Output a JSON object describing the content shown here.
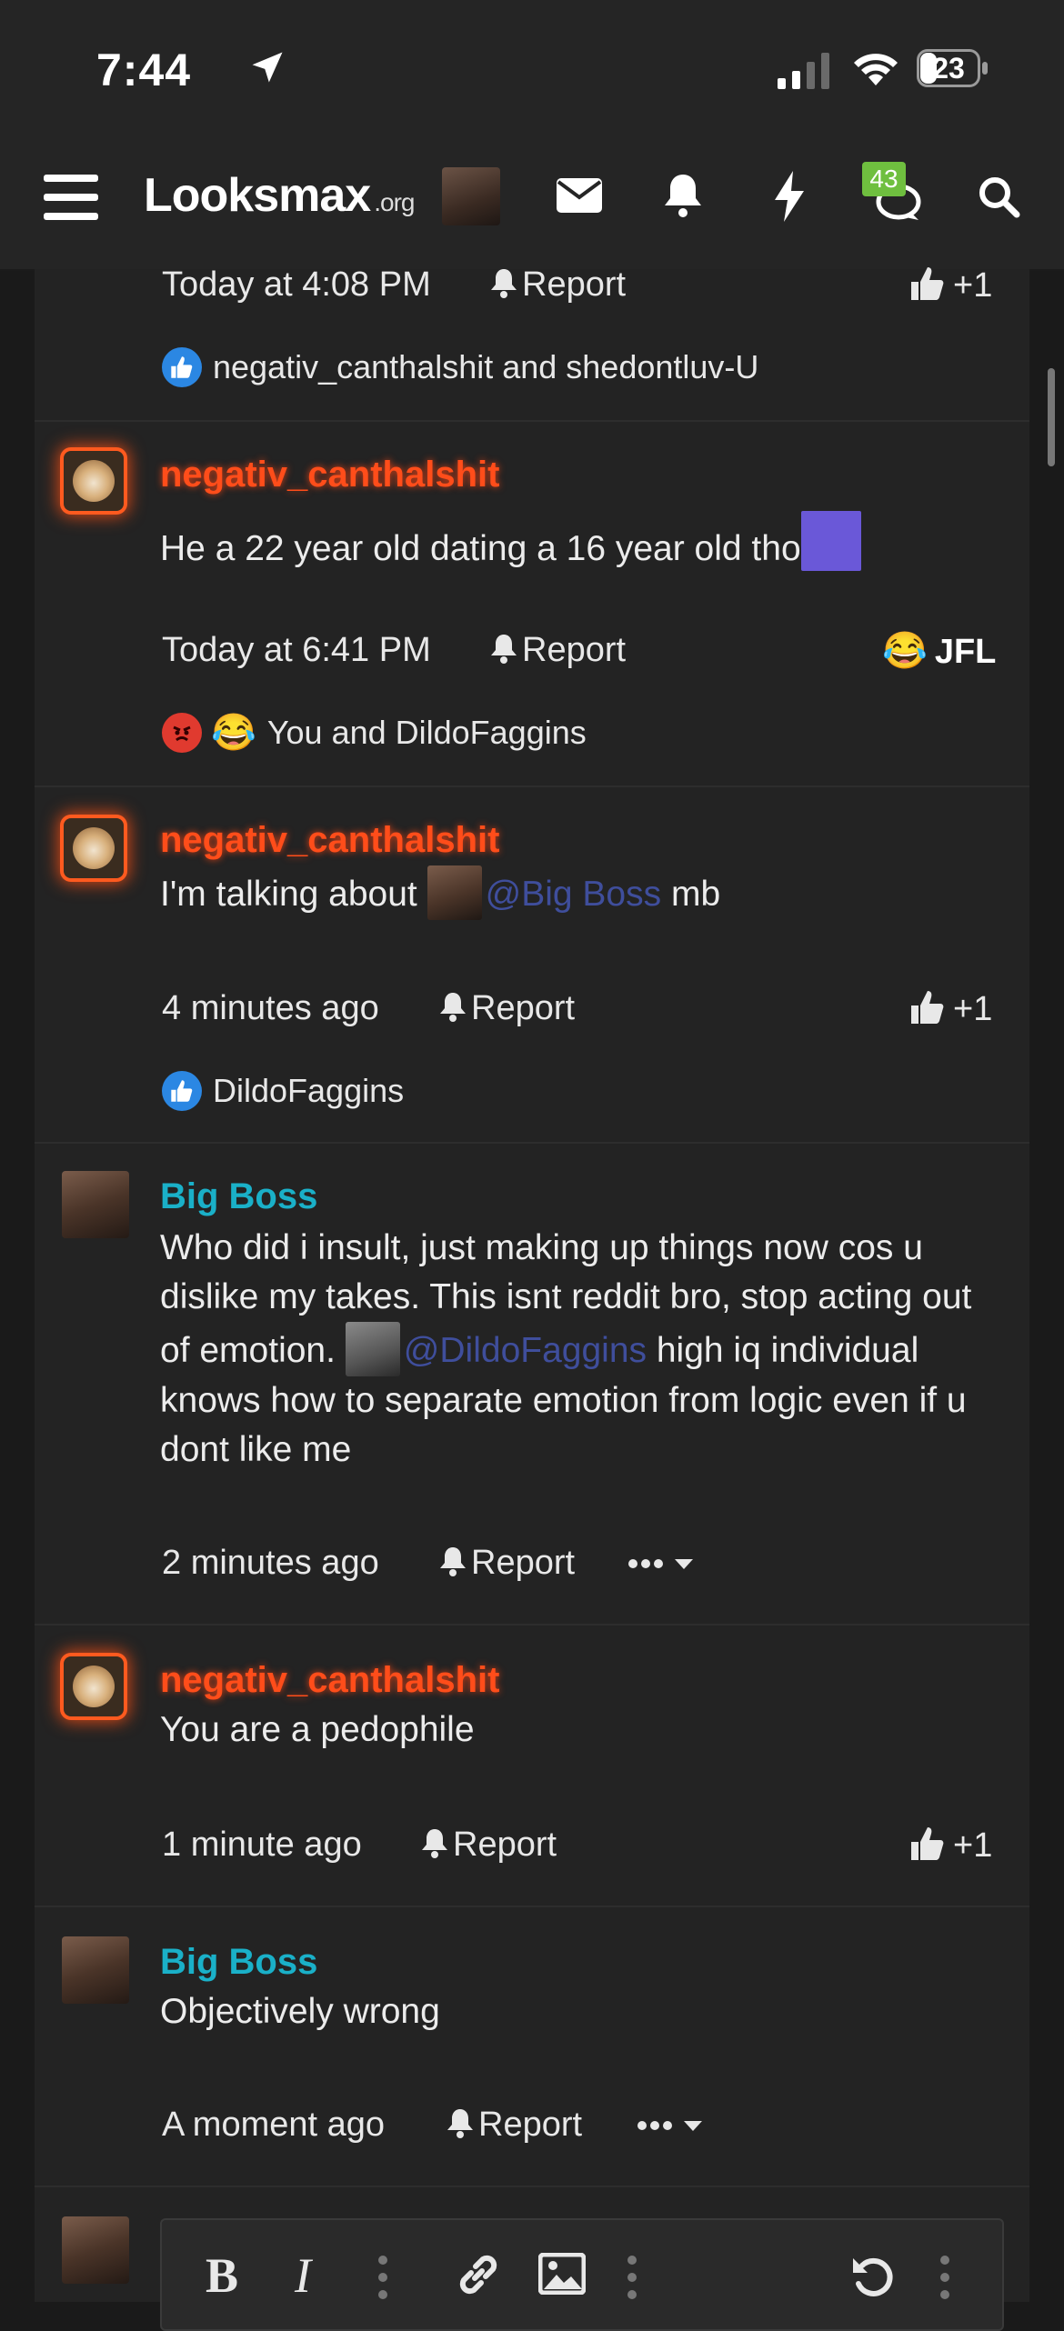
{
  "status_bar": {
    "time": "7:44",
    "battery": "23"
  },
  "nav": {
    "logo_main": "Looksmax",
    "logo_suffix": ".org",
    "notifications_badge": "43"
  },
  "posts": [
    {
      "time": "Today at 4:08 PM",
      "report": "Report",
      "reaction_right": "+1",
      "reactions_text": "negativ_canthalshit and shedontluv-U"
    },
    {
      "user": "negativ_canthalshit",
      "text": "He a 22 year old dating a 16 year old tho",
      "time": "Today at 6:41 PM",
      "report": "Report",
      "reaction_right": "JFL",
      "reactions_text": "You and DildoFaggins"
    },
    {
      "user": "negativ_canthalshit",
      "text_before": "I'm talking about",
      "mention": "@Big Boss",
      "text_after": "mb",
      "time": "4 minutes ago",
      "report": "Report",
      "reaction_right": "+1",
      "reactions_text": "DildoFaggins"
    },
    {
      "user": "Big Boss",
      "line1": "Who did i insult, just making up things now cos u",
      "line2": "dislike my takes. This isnt reddit bro, stop acting out",
      "line3_before": "of emotion.",
      "mention": "@DildoFaggins",
      "line3_after": "high iq individual",
      "line4": "knows how to separate emotion from logic even if u",
      "line5": "dont like me",
      "time": "2 minutes ago",
      "report": "Report"
    },
    {
      "user": "negativ_canthalshit",
      "text": "You are a pedophile",
      "time": "1 minute ago",
      "report": "Report",
      "reaction_right": "+1"
    },
    {
      "user": "Big Boss",
      "text": "Objectively wrong",
      "time": "A moment ago",
      "report": "Report"
    }
  ],
  "editor": {
    "bold": "B",
    "italic": "I"
  }
}
